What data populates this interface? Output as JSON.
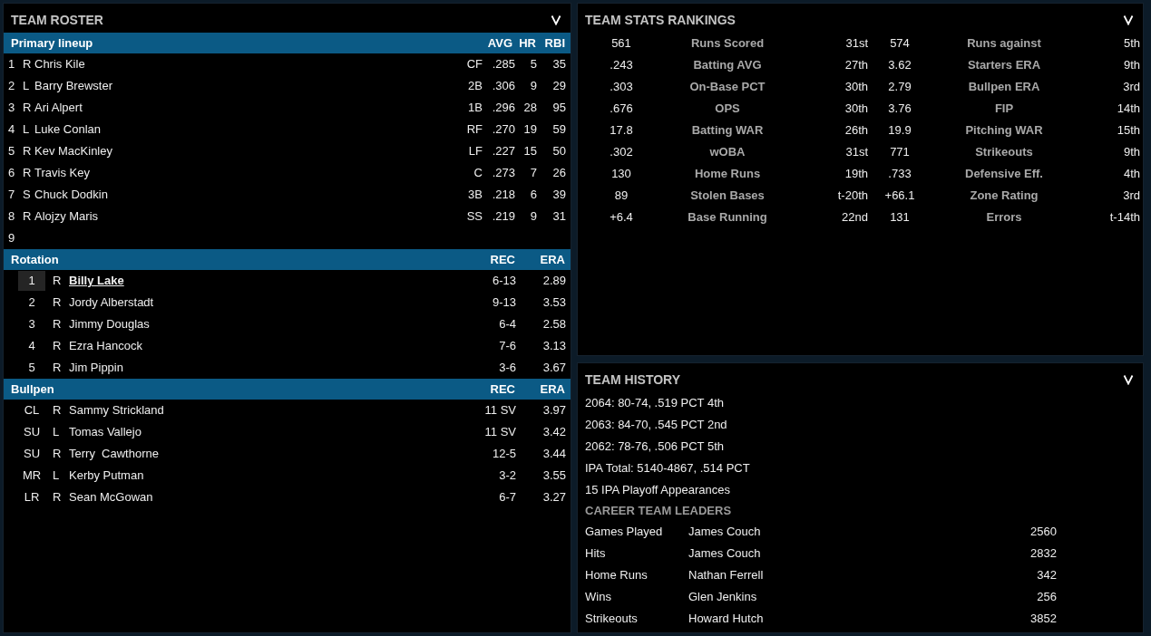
{
  "roster": {
    "title": "TEAM ROSTER",
    "lineup": {
      "title": "Primary lineup",
      "columns": [
        "AVG",
        "HR",
        "RBI"
      ],
      "rows": [
        {
          "order": "1",
          "hand": "R",
          "name": "Chris Kile",
          "pos": "CF",
          "avg": ".285",
          "hr": "5",
          "rbi": "35"
        },
        {
          "order": "2",
          "hand": "L",
          "name": "Barry Brewster",
          "pos": "2B",
          "avg": ".306",
          "hr": "9",
          "rbi": "29"
        },
        {
          "order": "3",
          "hand": "R",
          "name": "Ari Alpert",
          "pos": "1B",
          "avg": ".296",
          "hr": "28",
          "rbi": "95"
        },
        {
          "order": "4",
          "hand": "L",
          "name": "Luke Conlan",
          "pos": "RF",
          "avg": ".270",
          "hr": "19",
          "rbi": "59"
        },
        {
          "order": "5",
          "hand": "R",
          "name": "Kev MacKinley",
          "pos": "LF",
          "avg": ".227",
          "hr": "15",
          "rbi": "50"
        },
        {
          "order": "6",
          "hand": "R",
          "name": "Travis Key",
          "pos": "C",
          "avg": ".273",
          "hr": "7",
          "rbi": "26"
        },
        {
          "order": "7",
          "hand": "S",
          "name": "Chuck Dodkin",
          "pos": "3B",
          "avg": ".218",
          "hr": "6",
          "rbi": "39"
        },
        {
          "order": "8",
          "hand": "R",
          "name": "Alojzy Maris",
          "pos": "SS",
          "avg": ".219",
          "hr": "9",
          "rbi": "31"
        },
        {
          "order": "9"
        }
      ]
    },
    "rotation": {
      "title": "Rotation",
      "columns": [
        "REC",
        "ERA"
      ],
      "rows": [
        {
          "slot": "1",
          "hand": "R",
          "name": "Billy Lake",
          "rec": "6-13",
          "era": "2.89",
          "selected": true
        },
        {
          "slot": "2",
          "hand": "R",
          "name": "Jordy Alberstadt",
          "rec": "9-13",
          "era": "3.53",
          "selected": false
        },
        {
          "slot": "3",
          "hand": "R",
          "name": "Jimmy Douglas",
          "rec": "6-4",
          "era": "2.58",
          "selected": false
        },
        {
          "slot": "4",
          "hand": "R",
          "name": "Ezra Hancock",
          "rec": "7-6",
          "era": "3.13",
          "selected": false
        },
        {
          "slot": "5",
          "hand": "R",
          "name": "Jim Pippin",
          "rec": "3-6",
          "era": "3.67",
          "selected": false
        }
      ]
    },
    "bullpen": {
      "title": "Bullpen",
      "columns": [
        "REC",
        "ERA"
      ],
      "rows": [
        {
          "slot": "CL",
          "hand": "R",
          "name": "Sammy Strickland",
          "rec": "11 SV",
          "era": "3.97"
        },
        {
          "slot": "SU",
          "hand": "L",
          "name": "Tomas Vallejo",
          "rec": "11 SV",
          "era": "3.42"
        },
        {
          "slot": "SU",
          "hand": "R",
          "name": "Terry  Cawthorne",
          "rec": "12-5",
          "era": "3.44"
        },
        {
          "slot": "MR",
          "hand": "L",
          "name": "Kerby Putman",
          "rec": "3-2",
          "era": "3.55"
        },
        {
          "slot": "LR",
          "hand": "R",
          "name": "Sean McGowan",
          "rec": "6-7",
          "era": "3.27"
        }
      ]
    }
  },
  "stats": {
    "title": "TEAM STATS RANKINGS",
    "rows": [
      {
        "value": "561",
        "label": "Runs Scored",
        "rank": "31st",
        "value_2": "574",
        "label_2": "Runs against",
        "rank_2": "5th"
      },
      {
        "value": ".243",
        "label": "Batting AVG",
        "rank": "27th",
        "value_2": "3.62",
        "label_2": "Starters ERA",
        "rank_2": "9th"
      },
      {
        "value": ".303",
        "label": "On-Base PCT",
        "rank": "30th",
        "value_2": "2.79",
        "label_2": "Bullpen ERA",
        "rank_2": "3rd"
      },
      {
        "value": ".676",
        "label": "OPS",
        "rank": "30th",
        "value_2": "3.76",
        "label_2": "FIP",
        "rank_2": "14th"
      },
      {
        "value": "17.8",
        "label": "Batting WAR",
        "rank": "26th",
        "value_2": "19.9",
        "label_2": "Pitching WAR",
        "rank_2": "15th"
      },
      {
        "value": ".302",
        "label": "wOBA",
        "rank": "31st",
        "value_2": "771",
        "label_2": "Strikeouts",
        "rank_2": "9th"
      },
      {
        "value": "130",
        "label": "Home Runs",
        "rank": "19th",
        "value_2": ".733",
        "label_2": "Defensive Eff.",
        "rank_2": "4th"
      },
      {
        "value": "89",
        "label": "Stolen Bases",
        "rank": "t-20th",
        "value_2": "+66.1",
        "label_2": "Zone Rating",
        "rank_2": "3rd"
      },
      {
        "value": "+6.4",
        "label": "Base Running",
        "rank": "22nd",
        "value_2": "131",
        "label_2": "Errors",
        "rank_2": "t-14th"
      }
    ]
  },
  "history": {
    "title": "TEAM HISTORY",
    "lines": [
      "2064: 80-74, .519 PCT 4th",
      "2063: 84-70, .545 PCT 2nd",
      "2062: 78-76, .506 PCT 5th",
      "IPA Total: 5140-4867, .514 PCT",
      "15 IPA Playoff Appearances"
    ],
    "leaders_title": "CAREER TEAM LEADERS",
    "leaders": [
      {
        "category": "Games Played",
        "name": "James Couch",
        "value": "2560"
      },
      {
        "category": "Hits",
        "name": "James Couch",
        "value": "2832"
      },
      {
        "category": "Home Runs",
        "name": "Nathan Ferrell",
        "value": "342"
      },
      {
        "category": "Wins",
        "name": "Glen Jenkins",
        "value": "256"
      },
      {
        "category": "Strikeouts",
        "name": "Howard Hutch",
        "value": "3852"
      }
    ]
  }
}
